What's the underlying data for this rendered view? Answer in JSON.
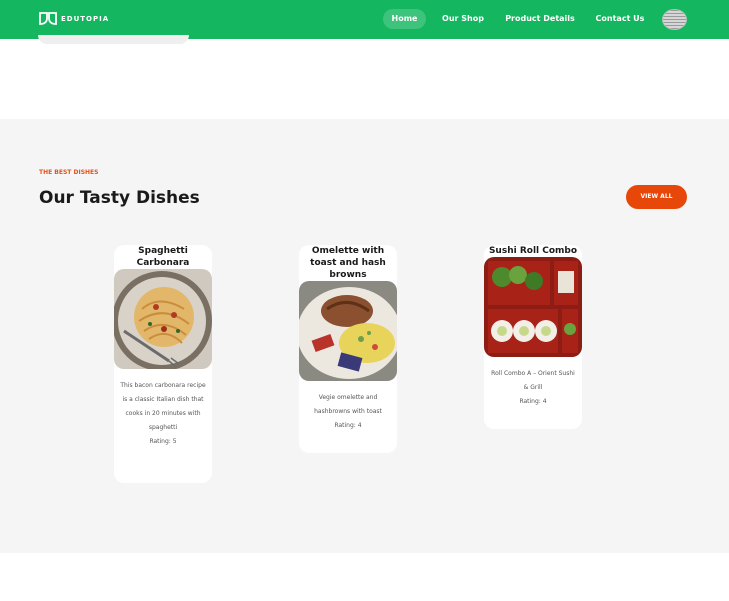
{
  "nav": {
    "brand": "EDUTOPIA",
    "items": [
      {
        "label": "Home"
      },
      {
        "label": "Our Shop"
      },
      {
        "label": "Product Details"
      },
      {
        "label": "Contact Us"
      }
    ]
  },
  "section": {
    "eyebrow": "THE BEST DISHES",
    "title": "Our Tasty Dishes",
    "view_all": "VIEW ALL"
  },
  "dishes": [
    {
      "title": "Spaghetti Carbonara",
      "description": "This bacon carbonara recipe is a classic Italian dish that cooks in 20 minutes with spaghetti",
      "rating": "Rating: 5"
    },
    {
      "title": "Omelette with toast and hash browns",
      "description": "Vegie omelette and hashbrowns with toast",
      "rating": "Rating: 4"
    },
    {
      "title": "Sushi Roll Combo",
      "description": "Roll Combo A – Orient Sushi & Grill",
      "rating": "Rating: 4"
    }
  ],
  "colors": {
    "nav_bg": "#14b660",
    "accent": "#e8470a",
    "section_bg": "#f5f5f5"
  }
}
